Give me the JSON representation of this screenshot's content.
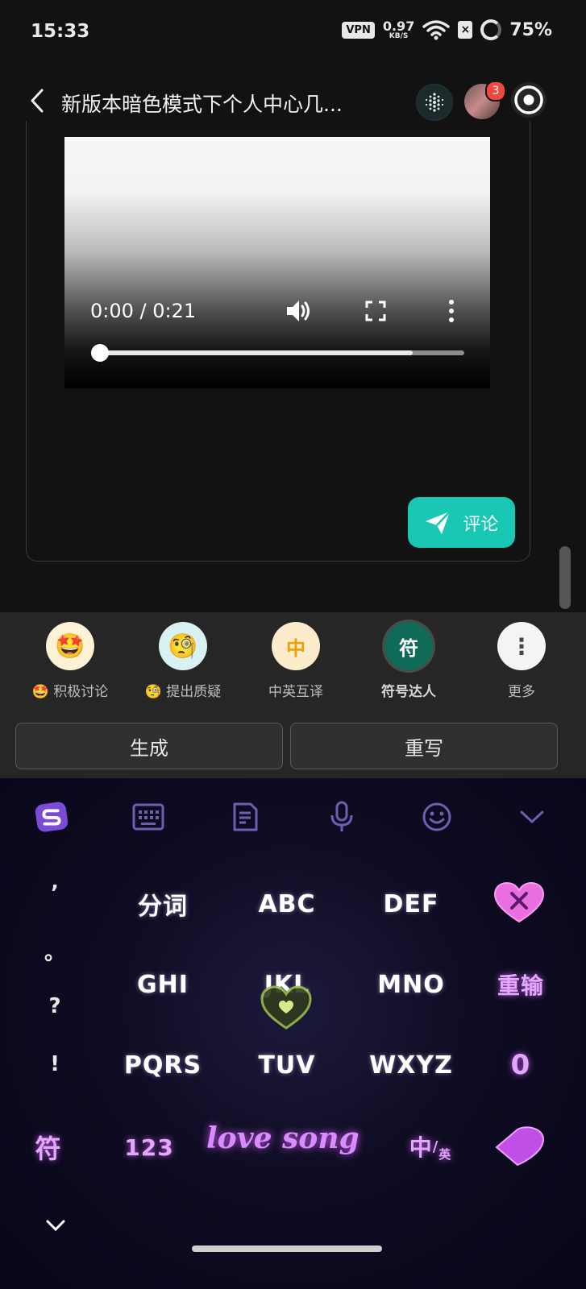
{
  "status_bar": {
    "time": "15:33",
    "vpn_label": "VPN",
    "net_speed_value": "0.97",
    "net_speed_unit": "KB/S",
    "battery": "75%"
  },
  "header": {
    "title": "新版本暗色模式下个人中心几...",
    "notification_count": "3"
  },
  "video": {
    "time_display": "0:00 / 0:21",
    "progress_fraction": 0.0,
    "buffered_fraction": 0.86
  },
  "comment_button": {
    "label": "评论"
  },
  "ai_assistant": {
    "options": [
      {
        "icon": "🤩",
        "label": "🤩 积极讨论"
      },
      {
        "icon": "🧐",
        "label": "🧐 提出质疑"
      },
      {
        "icon": "中",
        "label": "中英互译"
      },
      {
        "icon": "符",
        "label": "符号达人"
      },
      {
        "icon": "⋮",
        "label": "更多"
      }
    ],
    "generate_label": "生成",
    "rewrite_label": "重写"
  },
  "keyboard": {
    "punctuation": [
      "’",
      "。",
      "?",
      "!"
    ],
    "keys_row1": [
      "分词",
      "ABC",
      "DEF"
    ],
    "keys_row2": [
      "GHI",
      "JKL",
      "MNO"
    ],
    "keys_row3": [
      "PQRS",
      "TUV",
      "WXYZ"
    ],
    "reinput_label": "重输",
    "zero_label": "0",
    "symbol_label": "符",
    "num_label": "123",
    "space_label": "love song",
    "lang_switch_main": "中",
    "lang_switch_sub": "英"
  }
}
